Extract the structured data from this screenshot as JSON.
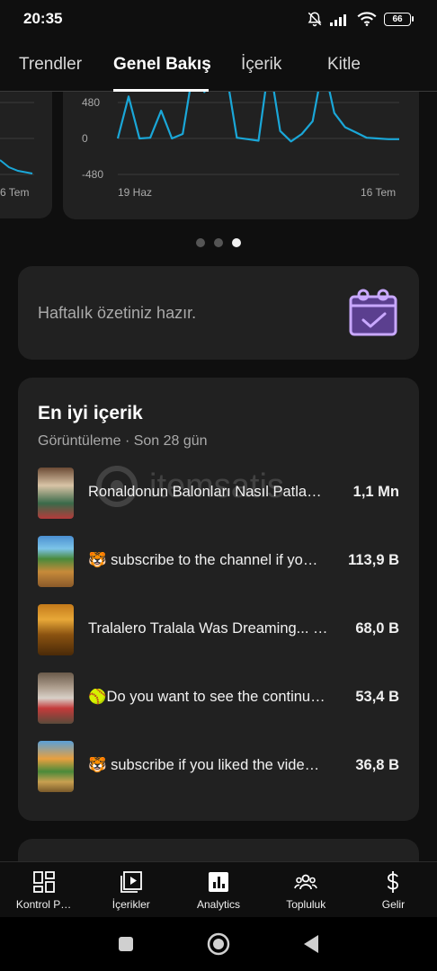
{
  "status": {
    "time": "20:35",
    "battery": "66"
  },
  "tabs": [
    {
      "label": "Trendler",
      "active": false
    },
    {
      "label": "Genel Bakış",
      "active": true
    },
    {
      "label": "İçerik",
      "active": false
    },
    {
      "label": "Kitle",
      "active": false
    }
  ],
  "prev_card": {
    "x_end_label": "6 Tem"
  },
  "chart_data": {
    "type": "line",
    "color": "#1aa7d8",
    "y_ticks": [
      "480",
      "0",
      "-480"
    ],
    "x_labels": [
      "19 Haz",
      "16 Tem"
    ],
    "ylim": [
      -480,
      480
    ],
    "values": [
      0,
      560,
      0,
      10,
      370,
      0,
      60,
      950,
      620,
      860,
      900,
      10,
      -10,
      -30,
      1020,
      100,
      -40,
      60,
      230,
      1000,
      340,
      150,
      80,
      10,
      0,
      -10,
      -10
    ],
    "grid": true
  },
  "carousel": {
    "pages": 3,
    "active": 2
  },
  "summary": {
    "text": "Haftalık özetiniz hazır."
  },
  "top_content": {
    "title": "En iyi içerik",
    "subtitle": "Görüntüleme · Son 28 gün",
    "items": [
      {
        "title": "Ronaldonun Balonları Nasıl Patla…",
        "value": "1,1 Mn"
      },
      {
        "title": "🐯 subscribe to the channel if yo…",
        "value": "113,9 B"
      },
      {
        "title": "Tralalero Tralala Was Dreaming... …",
        "value": "68,0 B"
      },
      {
        "title": "🥎Do you want to see the continu…",
        "value": "53,4 B"
      },
      {
        "title": "🐯 subscribe if you liked the vide…",
        "value": "36,8 B"
      }
    ]
  },
  "watermark": {
    "text": "itemsatis"
  },
  "bottom_nav": [
    {
      "label": "Kontrol P…",
      "icon": "dashboard-icon"
    },
    {
      "label": "İçerikler",
      "icon": "content-icon"
    },
    {
      "label": "Analytics",
      "icon": "analytics-icon"
    },
    {
      "label": "Topluluk",
      "icon": "community-icon"
    },
    {
      "label": "Gelir",
      "icon": "earn-icon"
    }
  ]
}
